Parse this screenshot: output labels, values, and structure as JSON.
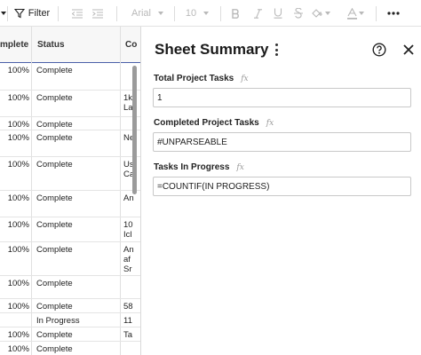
{
  "toolbar": {
    "filter_label": "Filter",
    "font_name": "Arial",
    "font_size": "10"
  },
  "grid": {
    "headers": [
      "mplete",
      "Status",
      "Co"
    ],
    "rows": [
      {
        "pct": "100%",
        "status": "Complete",
        "comment": ""
      },
      {
        "pct": "100%",
        "status": "Complete",
        "comment": "1k La"
      },
      {
        "pct": "100%",
        "status": "Complete",
        "comment": ""
      },
      {
        "pct": "100%",
        "status": "Complete",
        "comment": "Ne"
      },
      {
        "pct": "100%",
        "status": "Complete",
        "comment": "Us Ca"
      },
      {
        "pct": "100%",
        "status": "Complete",
        "comment": "An"
      },
      {
        "pct": "100%",
        "status": "Complete",
        "comment": "10 Icl"
      },
      {
        "pct": "100%",
        "status": "Complete",
        "comment": "An af Sr"
      },
      {
        "pct": "100%",
        "status": "Complete",
        "comment": ""
      },
      {
        "pct": "100%",
        "status": "Complete",
        "comment": "58"
      },
      {
        "pct": "",
        "status": "In Progress",
        "comment": "11"
      },
      {
        "pct": "100%",
        "status": "Complete",
        "comment": "Ta"
      },
      {
        "pct": "100%",
        "status": "Complete",
        "comment": ""
      }
    ]
  },
  "panel": {
    "title": "Sheet Summary",
    "fields": [
      {
        "label": "Total Project Tasks",
        "value": "1"
      },
      {
        "label": "Completed Project Tasks",
        "value": "#UNPARSEABLE"
      },
      {
        "label": "Tasks In Progress",
        "value": "=COUNTIF(IN PROGRESS)"
      }
    ],
    "fx_symbol": "fx"
  }
}
